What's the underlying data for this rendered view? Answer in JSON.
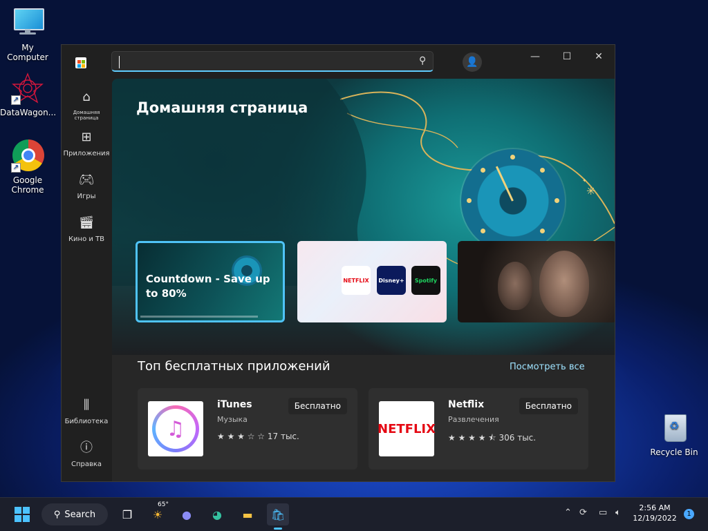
{
  "desktop": {
    "icons": [
      {
        "label": "My Computer"
      },
      {
        "label": "DataWagon..."
      },
      {
        "label": "Google Chrome"
      },
      {
        "label": "Recycle Bin"
      }
    ]
  },
  "window": {
    "search": {
      "value": "",
      "placeholder": ""
    },
    "nav": [
      {
        "label": "Домашняя страница",
        "icon": "home-icon"
      },
      {
        "label": "Приложения",
        "icon": "apps-icon"
      },
      {
        "label": "Игры",
        "icon": "gamepad-icon"
      },
      {
        "label": "Кино и ТВ",
        "icon": "clapperboard-icon"
      },
      {
        "label": "Библиотека",
        "icon": "library-icon"
      },
      {
        "label": "Справка",
        "icon": "help-icon"
      }
    ],
    "hero": {
      "title": "Домашняя страница",
      "cards": [
        {
          "text": "Countdown - Save up to 80%"
        },
        {
          "tiles": [
            "NETFLIX",
            "Disney+",
            "Spotify"
          ]
        },
        {
          "text": ""
        }
      ]
    },
    "top_free": {
      "title": "Топ бесплатных приложений",
      "see_all": "Посмотреть все",
      "apps": [
        {
          "name": "iTunes",
          "category": "Музыка",
          "stars": "★ ★ ★ ☆ ☆",
          "reviews": "17 тыс.",
          "price": "Бесплатно"
        },
        {
          "name": "Netflix",
          "category": "Развлечения",
          "stars": "★ ★ ★ ★ ⯪",
          "reviews": "306 тыс.",
          "price": "Бесплатно",
          "logo_text": "NETFLIX"
        }
      ]
    }
  },
  "taskbar": {
    "search_label": "Search",
    "weather": "65°",
    "time": "2:56 AM",
    "date": "12/19/2022",
    "notifications": "1"
  },
  "colors": {
    "accent": "#60cdff",
    "hero_teal": "#1b9a9a",
    "netflix_red": "#e50914"
  }
}
